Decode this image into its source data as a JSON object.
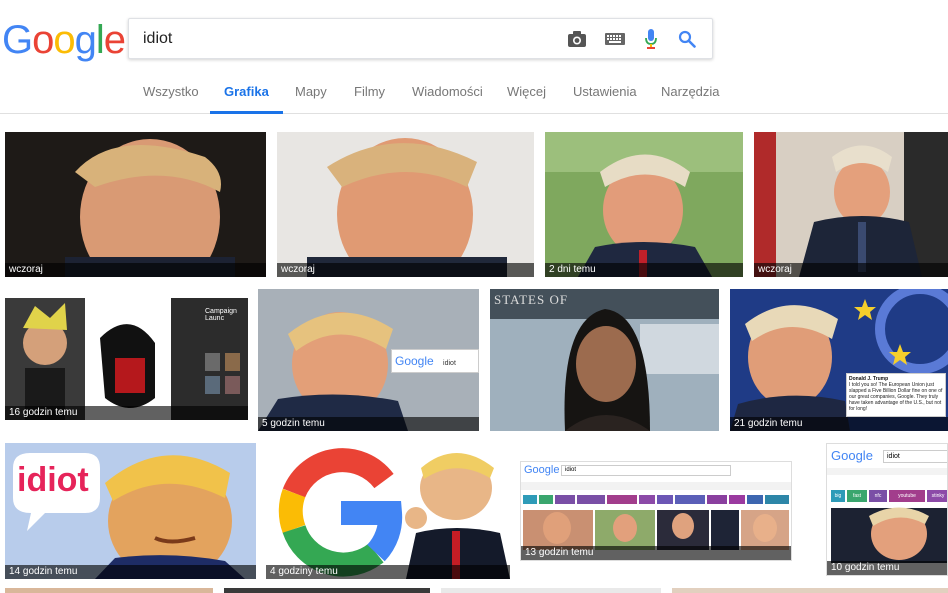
{
  "logo": {
    "letters": [
      "G",
      "o",
      "o",
      "g",
      "l",
      "e"
    ],
    "colors": [
      "#4285F4",
      "#EA4335",
      "#FBBC05",
      "#4285F4",
      "#34A853",
      "#EA4335"
    ]
  },
  "search": {
    "query": "idiot"
  },
  "icons": {
    "camera": "camera-icon",
    "keyboard": "keyboard-icon",
    "mic": "microphone-icon",
    "search": "search-icon"
  },
  "tabs": [
    {
      "label": "Wszystko",
      "active": false
    },
    {
      "label": "Grafika",
      "active": true
    },
    {
      "label": "Mapy",
      "active": false
    },
    {
      "label": "Filmy",
      "active": false
    },
    {
      "label": "Wiadomości",
      "active": false
    },
    {
      "label": "Więcej",
      "active": false
    },
    {
      "label": "Ustawienia",
      "active": false
    },
    {
      "label": "Narzędzia",
      "active": false
    }
  ],
  "results": [
    {
      "caption": "wczoraj"
    },
    {
      "caption": "wczoraj"
    },
    {
      "caption": "2 dni temu"
    },
    {
      "caption": "wczoraj"
    },
    {
      "caption": "16 godzin temu",
      "inner_text": "Campaign Launc"
    },
    {
      "caption": "5 godzin temu",
      "inner_logo": "Google",
      "inner_query": "idiot"
    },
    {
      "caption": "",
      "inner_text": "STATES OF"
    },
    {
      "caption": "21 godzin temu",
      "inner_text": "I told you so! The European Union just slapped a Five Billion Dollar fine on one of our great companies, Google. They truly have taken advantage of the U.S., but not for long!",
      "inner_author": "Donald J. Trump"
    },
    {
      "caption": "14 godzin temu",
      "inner_text": "idiot"
    },
    {
      "caption": "4 godziny temu"
    },
    {
      "caption": "13 godzin temu",
      "inner_logo": "Google",
      "inner_query": "idiot"
    },
    {
      "caption": "10 godzin temu",
      "inner_logo": "Google",
      "inner_query": "idiot",
      "inner_tags": [
        "big",
        "fast",
        "nfc",
        "youtube",
        "stinky"
      ]
    }
  ],
  "colors": {
    "accent": "#1a73e8",
    "tab_text": "#777777",
    "caption_bg": "#000000"
  }
}
